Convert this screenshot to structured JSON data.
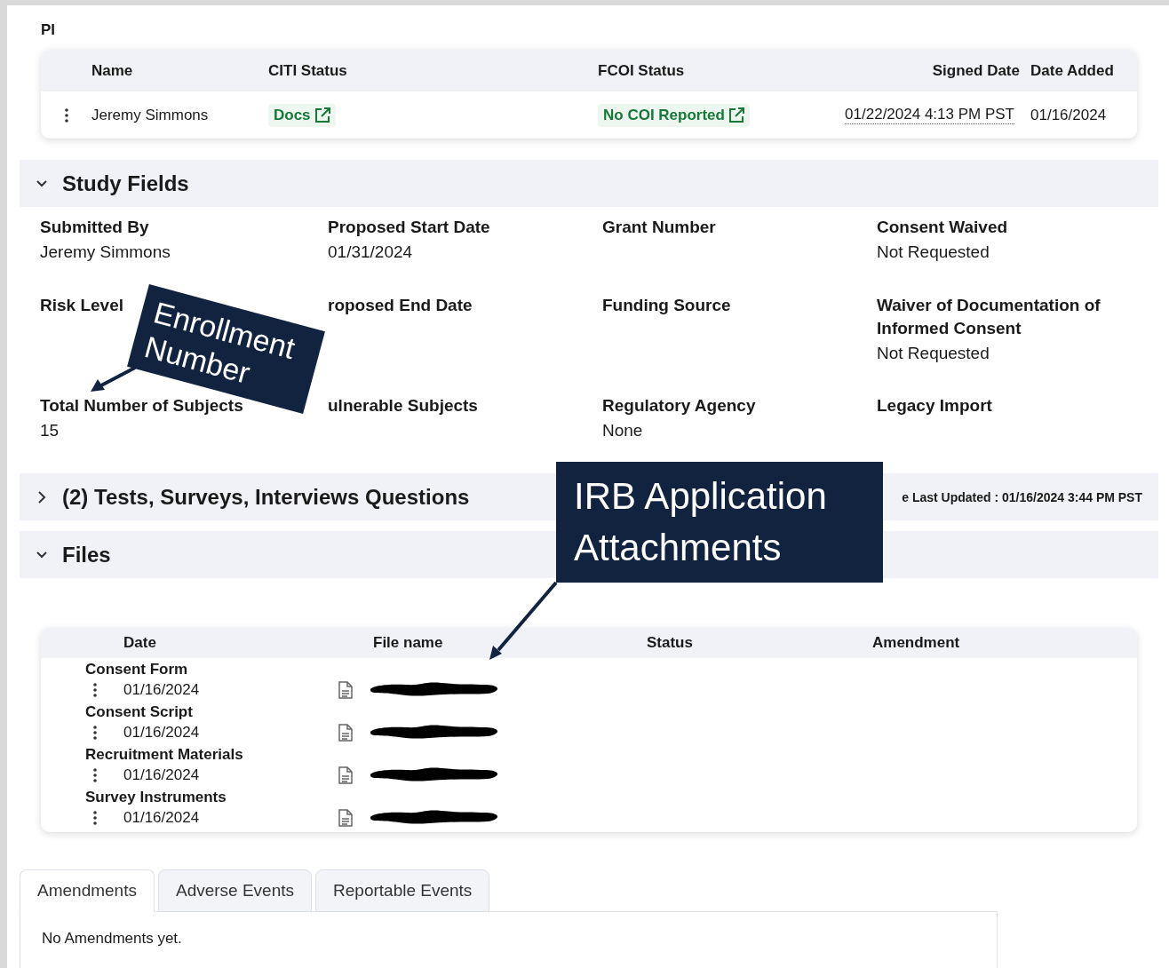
{
  "pi": {
    "title": "PI",
    "columns": [
      "Name",
      "CITI Status",
      "FCOI Status",
      "Signed Date",
      "Date Added"
    ],
    "rows": [
      {
        "name": "Jeremy Simmons",
        "citi_status": "Docs",
        "fcoi_status": "No COI Reported",
        "signed_date": "01/22/2024 4:13 PM PST",
        "date_added": "01/16/2024"
      }
    ]
  },
  "study_fields": {
    "title": "Study Fields",
    "expanded": true,
    "fields": [
      {
        "label": "Submitted By",
        "value": "Jeremy Simmons"
      },
      {
        "label": "Proposed Start Date",
        "value": "01/31/2024"
      },
      {
        "label": "Grant Number"
      },
      {
        "label": "Consent Waived",
        "value": "Not Requested"
      },
      {
        "label": "Risk Level"
      },
      {
        "label": "roposed End Date"
      },
      {
        "label": "Funding Source"
      },
      {
        "label": "Waiver of Documentation of Informed Consent",
        "value": "Not Requested"
      },
      {
        "label": "Total Number of Subjects",
        "value": "15"
      },
      {
        "label": "ulnerable Subjects"
      },
      {
        "label": "Regulatory Agency",
        "value": "None"
      },
      {
        "label": "Legacy Import"
      }
    ]
  },
  "tests_section": {
    "title": "(2) Tests, Surveys, Interviews Questions",
    "expanded": false,
    "last_updated": "e Last Updated : 01/16/2024 3:44 PM PST"
  },
  "files": {
    "title": "Files",
    "expanded": true,
    "columns": [
      "Date",
      "File name",
      "Status",
      "Amendment"
    ],
    "rows": [
      {
        "category": "Consent Form",
        "date": "01/16/2024"
      },
      {
        "category": "Consent Script",
        "date": "01/16/2024"
      },
      {
        "category": "Recruitment Materials",
        "date": "01/16/2024"
      },
      {
        "category": "Survey Instruments",
        "date": "01/16/2024"
      }
    ]
  },
  "tabs": [
    {
      "label": "Amendments",
      "selected": true
    },
    {
      "label": "Adverse Events",
      "selected": false
    },
    {
      "label": "Reportable Events",
      "selected": false
    }
  ],
  "tab_panel": {
    "text": "No Amendments yet."
  },
  "callouts": [
    {
      "text": "Enrollment Number"
    },
    {
      "text": "IRB Application Attachments"
    }
  ]
}
